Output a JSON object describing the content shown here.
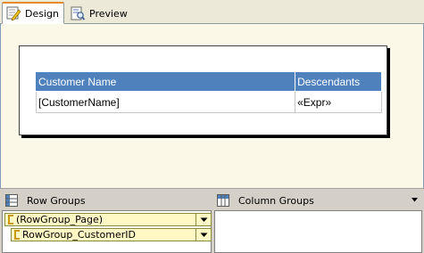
{
  "tabs": [
    {
      "label": "Design",
      "active": true,
      "icon": "design-icon"
    },
    {
      "label": "Preview",
      "active": false,
      "icon": "preview-icon"
    }
  ],
  "table": {
    "header": [
      "Customer Name",
      "Descendants"
    ],
    "detail": [
      "[CustomerName]",
      "«Expr»"
    ],
    "header_color": "#4f81bd"
  },
  "grouping": {
    "row_groups_label": "Row Groups",
    "column_groups_label": "Column Groups",
    "row_groups": [
      {
        "name": "(RowGroup_Page)"
      },
      {
        "name": "RowGroup_CustomerID"
      }
    ]
  },
  "colors": {
    "surface": "#fbf8e8",
    "group_item": "#fff7c4",
    "tab_accent": "#e68b2c"
  }
}
